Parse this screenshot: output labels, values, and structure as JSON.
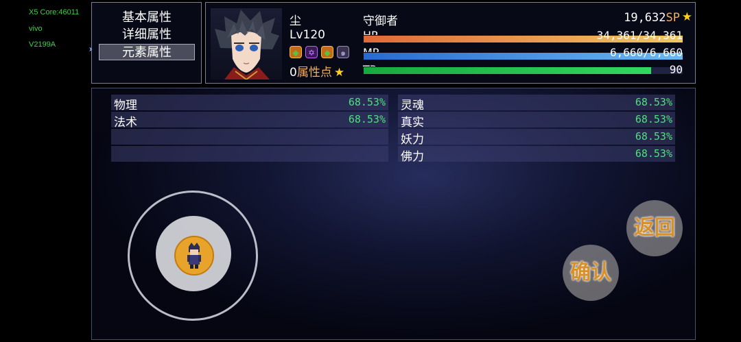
{
  "device_overlay": {
    "core": "X5 Core:46011",
    "brand": "vivo",
    "model": "V2199A"
  },
  "menu": {
    "items": [
      "基本属性",
      "详细属性",
      "元素属性"
    ],
    "selected_index": 2
  },
  "status": {
    "name": "尘",
    "class": "守御者",
    "level": "Lv120",
    "sp": "19,632",
    "sp_unit": "SP",
    "attribute_points": "0",
    "attribute_points_label": "属性点",
    "state_icons": [
      "shield-icon",
      "pentagram-icon",
      "shield-icon",
      "swirl-icon"
    ],
    "hp": {
      "label": "HP",
      "text": "34,361/34,361",
      "ratio": 1.0
    },
    "mp": {
      "label": "MP",
      "text": "6,660/6,660",
      "ratio": 1.0
    },
    "tp": {
      "label": "TP",
      "text": "90",
      "ratio": 0.9
    }
  },
  "elements": {
    "left": [
      {
        "name": "物理",
        "value": "68.53%"
      },
      {
        "name": "法术",
        "value": "68.53%"
      },
      {
        "name": "",
        "value": ""
      },
      {
        "name": "",
        "value": ""
      }
    ],
    "right": [
      {
        "name": "灵魂",
        "value": "68.53%"
      },
      {
        "name": "真实",
        "value": "68.53%"
      },
      {
        "name": "妖力",
        "value": "68.53%"
      },
      {
        "name": "佛力",
        "value": "68.53%"
      }
    ]
  },
  "buttons": {
    "back": "返回",
    "confirm": "确认"
  },
  "colors": {
    "hp_fill": "#f0a850",
    "mp_fill": "#3f8fe0",
    "tp_fill": "#20c050",
    "value_green": "#4ee07e"
  }
}
